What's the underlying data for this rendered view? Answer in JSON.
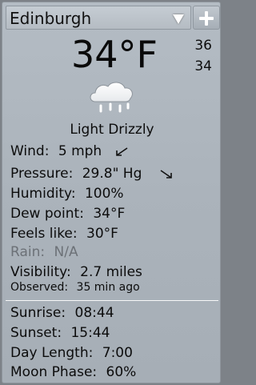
{
  "location": "Edinburgh",
  "current": {
    "temperature": "34°F",
    "high": "36",
    "low": "34",
    "condition": "Light Drizzly"
  },
  "details": {
    "wind_label": "Wind:",
    "wind_value": "5 mph",
    "pressure_label": "Pressure:",
    "pressure_value": "29.8\" Hg",
    "humidity_label": "Humidity:",
    "humidity_value": "100%",
    "dew_label": "Dew point:",
    "dew_value": "34°F",
    "feels_label": "Feels like:",
    "feels_value": "30°F",
    "rain_label": "Rain:",
    "rain_value": "N/A",
    "visibility_label": "Visibility:",
    "visibility_value": "2.7 miles",
    "observed_label": "Observed:",
    "observed_value": "35 min ago"
  },
  "sun": {
    "sunrise_label": "Sunrise:",
    "sunrise_value": "08:44",
    "sunset_label": "Sunset:",
    "sunset_value": "15:44",
    "daylength_label": "Day Length:",
    "daylength_value": "7:00",
    "moon_label": "Moon Phase:",
    "moon_value": "60%"
  },
  "icons": {
    "weather": "cloud-drizzle-icon",
    "add": "plus-icon",
    "dropdown": "triangle-down-icon",
    "wind_direction": "arrow-southwest-icon",
    "pressure_trend": "arrow-southeast-icon"
  },
  "colors": {
    "panel": "#adb5bd",
    "text": "#0c0c0c",
    "muted": "#6c7177"
  }
}
